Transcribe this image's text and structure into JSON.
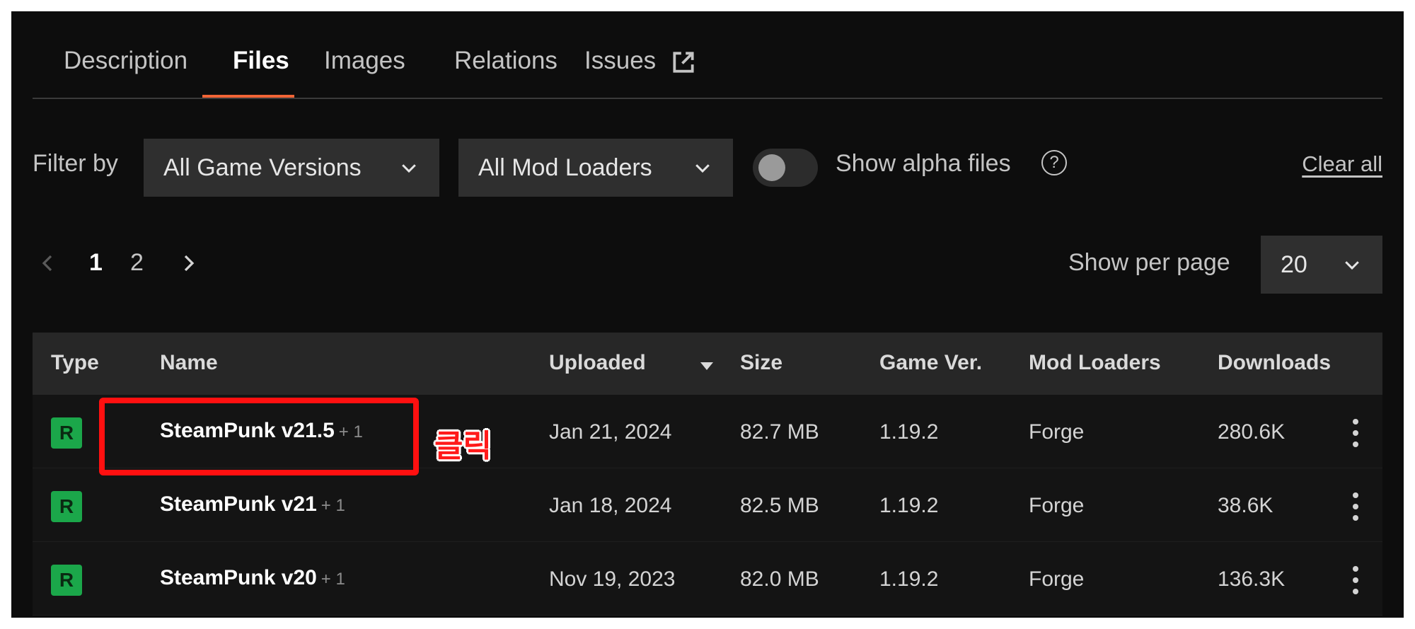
{
  "tabs": [
    {
      "label": "Description"
    },
    {
      "label": "Files"
    },
    {
      "label": "Images"
    },
    {
      "label": "Relations"
    },
    {
      "label": "Issues"
    }
  ],
  "filters": {
    "label": "Filter by",
    "game_versions": "All Game Versions",
    "mod_loaders": "All Mod Loaders",
    "alpha_label": "Show alpha files",
    "help": "?",
    "clear_all": "Clear all"
  },
  "pagination": {
    "pages": [
      "1",
      "2"
    ],
    "current": "1",
    "per_page_label": "Show per page",
    "per_page_value": "20"
  },
  "table": {
    "headers": {
      "type": "Type",
      "name": "Name",
      "uploaded": "Uploaded",
      "size": "Size",
      "game_ver": "Game Ver.",
      "mod_loaders": "Mod Loaders",
      "downloads": "Downloads"
    },
    "rows": [
      {
        "type": "R",
        "name": "SteamPunk v21.5",
        "extra": "+ 1",
        "uploaded": "Jan 21, 2024",
        "size": "82.7 MB",
        "game_ver": "1.19.2",
        "loader": "Forge",
        "downloads": "280.6K"
      },
      {
        "type": "R",
        "name": "SteamPunk v21",
        "extra": "+ 1",
        "uploaded": "Jan 18, 2024",
        "size": "82.5 MB",
        "game_ver": "1.19.2",
        "loader": "Forge",
        "downloads": "38.6K"
      },
      {
        "type": "R",
        "name": "SteamPunk v20",
        "extra": "+ 1",
        "uploaded": "Nov 19, 2023",
        "size": "82.0 MB",
        "game_ver": "1.19.2",
        "loader": "Forge",
        "downloads": "136.3K"
      }
    ]
  },
  "annotation": {
    "text": "클릭"
  },
  "colors": {
    "accent": "#f16436",
    "release_badge": "#1ba74a",
    "annotation": "#ff1010"
  }
}
